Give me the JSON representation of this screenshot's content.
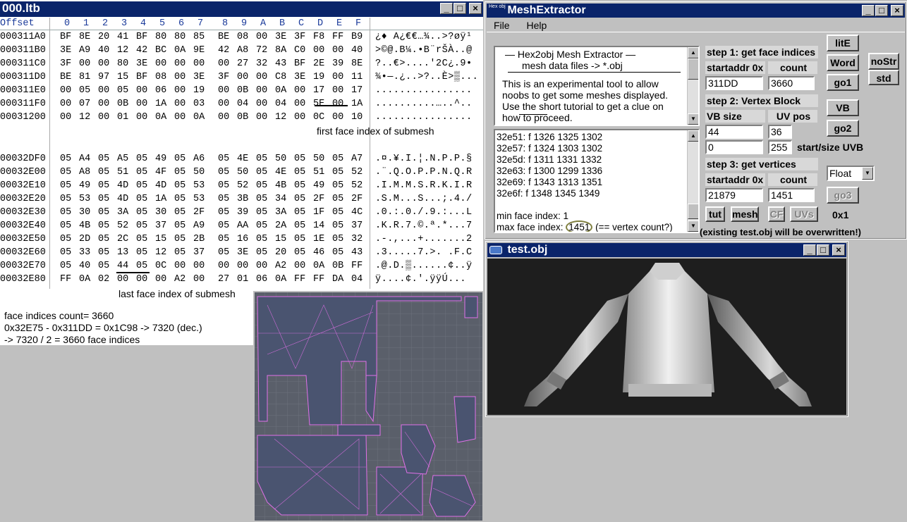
{
  "hex_window": {
    "title": "000.ltb",
    "header_offset": "Offset",
    "header_cols": [
      "0",
      "1",
      "2",
      "3",
      "4",
      "5",
      "6",
      "7",
      "8",
      "9",
      "A",
      "B",
      "C",
      "D",
      "E",
      "F"
    ],
    "block1": [
      {
        "off": "000311A0",
        "bytes": [
          "BF",
          "8E",
          "20",
          "41",
          "BF",
          "80",
          "80",
          "85",
          "BE",
          "08",
          "00",
          "3E",
          "3F",
          "F8",
          "FF",
          "B9"
        ],
        "ascii": "¿♦ A¿€€…¾..>?øÿ¹"
      },
      {
        "off": "000311B0",
        "bytes": [
          "3E",
          "A9",
          "40",
          "12",
          "42",
          "BC",
          "0A",
          "9E",
          "42",
          "A8",
          "72",
          "8A",
          "C0",
          "00",
          "00",
          "40"
        ],
        "ascii": ">©@.B¼.•B¨rŠÀ..@"
      },
      {
        "off": "000311C0",
        "bytes": [
          "3F",
          "00",
          "00",
          "80",
          "3E",
          "00",
          "00",
          "00",
          "00",
          "27",
          "32",
          "43",
          "BF",
          "2E",
          "39",
          "8E"
        ],
        "ascii": "?..€>....'2C¿.9•"
      },
      {
        "off": "000311D0",
        "bytes": [
          "BE",
          "81",
          "97",
          "15",
          "BF",
          "08",
          "00",
          "3E",
          "3F",
          "00",
          "00",
          "C8",
          "3E",
          "19",
          "00",
          "11"
        ],
        "ascii": "¾•—.¿..>?..È>▒..."
      },
      {
        "off": "000311E0",
        "bytes": [
          "00",
          "05",
          "00",
          "05",
          "00",
          "06",
          "00",
          "19",
          "00",
          "0B",
          "00",
          "0A",
          "00",
          "17",
          "00",
          "17"
        ],
        "ascii": "................"
      },
      {
        "off": "000311F0",
        "bytes": [
          "00",
          "07",
          "00",
          "0B",
          "00",
          "1A",
          "00",
          "03",
          "00",
          "04",
          "00",
          "04",
          "00",
          "5E",
          "00",
          "1A"
        ],
        "ascii": "..........…..^.."
      },
      {
        "off": "00031200",
        "bytes": [
          "00",
          "12",
          "00",
          "01",
          "00",
          "0A",
          "00",
          "0A",
          "00",
          "0B",
          "00",
          "12",
          "00",
          "0C",
          "00",
          "10"
        ],
        "ascii": "................"
      }
    ],
    "caption1": "first face index of submesh",
    "block2": [
      {
        "off": "00032DF0",
        "bytes": [
          "05",
          "A4",
          "05",
          "A5",
          "05",
          "49",
          "05",
          "A6",
          "05",
          "4E",
          "05",
          "50",
          "05",
          "50",
          "05",
          "A7"
        ],
        "ascii": ".¤.¥.I.¦.N.P.P.§"
      },
      {
        "off": "00032E00",
        "bytes": [
          "05",
          "A8",
          "05",
          "51",
          "05",
          "4F",
          "05",
          "50",
          "05",
          "50",
          "05",
          "4E",
          "05",
          "51",
          "05",
          "52"
        ],
        "ascii": ".¨.Q.O.P.P.N.Q.R"
      },
      {
        "off": "00032E10",
        "bytes": [
          "05",
          "49",
          "05",
          "4D",
          "05",
          "4D",
          "05",
          "53",
          "05",
          "52",
          "05",
          "4B",
          "05",
          "49",
          "05",
          "52"
        ],
        "ascii": ".I.M.M.S.R.K.I.R"
      },
      {
        "off": "00032E20",
        "bytes": [
          "05",
          "53",
          "05",
          "4D",
          "05",
          "1A",
          "05",
          "53",
          "05",
          "3B",
          "05",
          "34",
          "05",
          "2F",
          "05",
          "2F"
        ],
        "ascii": ".S.M...S...;.4./"
      },
      {
        "off": "00032E30",
        "bytes": [
          "05",
          "30",
          "05",
          "3A",
          "05",
          "30",
          "05",
          "2F",
          "05",
          "39",
          "05",
          "3A",
          "05",
          "1F",
          "05",
          "4C"
        ],
        "ascii": ".0.:.0./.9.:...L"
      },
      {
        "off": "00032E40",
        "bytes": [
          "05",
          "4B",
          "05",
          "52",
          "05",
          "37",
          "05",
          "A9",
          "05",
          "AA",
          "05",
          "2A",
          "05",
          "14",
          "05",
          "37"
        ],
        "ascii": ".K.R.7.©.ª.*...7"
      },
      {
        "off": "00032E50",
        "bytes": [
          "05",
          "2D",
          "05",
          "2C",
          "05",
          "15",
          "05",
          "2B",
          "05",
          "16",
          "05",
          "15",
          "05",
          "1E",
          "05",
          "32"
        ],
        "ascii": ".-.,...+.......2"
      },
      {
        "off": "00032E60",
        "bytes": [
          "05",
          "33",
          "05",
          "13",
          "05",
          "12",
          "05",
          "37",
          "05",
          "3E",
          "05",
          "20",
          "05",
          "46",
          "05",
          "43"
        ],
        "ascii": ".3.....7.>. .F.C"
      },
      {
        "off": "00032E70",
        "bytes": [
          "05",
          "40",
          "05",
          "44",
          "05",
          "0C",
          "00",
          "00",
          "00",
          "00",
          "00",
          "A2",
          "00",
          "0A",
          "0B",
          "FF"
        ],
        "ascii": ".@.D.▒......¢..ÿ"
      },
      {
        "off": "00032E80",
        "bytes": [
          "FF",
          "0A",
          "02",
          "00",
          "00",
          "00",
          "A2",
          "00",
          "27",
          "01",
          "06",
          "0A",
          "FF",
          "FF",
          "DA",
          "04"
        ],
        "ascii": "ÿ....¢.'.ÿÿÚ..."
      }
    ],
    "caption2": "last face index of submesh",
    "notes": [
      "face indices count= 3660",
      "0x32E75 - 0x311DD = 0x1C98 -> 7320 (dec.)",
      "-> 7320 / 2 = 3660 face indices"
    ]
  },
  "mesh_window": {
    "logo": "Hex obj",
    "title": "MeshExtractor",
    "menu": [
      "File",
      "Help"
    ],
    "about_lines": [
      "—  Hex2obj Mesh Extractor  —",
      "mesh data files -> *.obj",
      "",
      "This is an experimental tool to allow",
      "noobs to get some meshes displayed.",
      "Use the short tutorial to get a clue on",
      "how to proceed."
    ],
    "log_lines": [
      "32e51: f  1326 1325 1302",
      "32e57: f  1324 1303 1302",
      "32e5d: f  1311 1331 1332",
      "32e63: f  1300 1299 1336",
      "32e69: f  1343 1313 1351",
      "32e6f: f  1348 1345 1349",
      "",
      "min face index: 1"
    ],
    "log_max_prefix": "max face index: ",
    "log_max_value": "1451",
    "log_max_suffix": " (== vertex count?)",
    "step1": "step 1: get face indices",
    "startaddr_label": "startaddr 0x",
    "count_label": "count",
    "startaddr1": "311DD",
    "count1": "3660",
    "go1": "go1",
    "step2": "step 2: Vertex Block",
    "vbsize_label": "VB size",
    "uvpos_label": "UV pos",
    "vbsize": "44",
    "uvpos": "36",
    "go2": "go2",
    "vb_btn": "VB",
    "uvb_start": "0",
    "uvb_size": "255",
    "uvb_label": "start/size UVB",
    "step3": "step 3: get vertices",
    "startaddr3": "21879",
    "count3": "1451",
    "go3": "go3",
    "format": "Float",
    "btn_lite": "litE",
    "btn_word": "Word",
    "btn_nostr": "noStr",
    "btn_std": "std",
    "btn_tut": "tut",
    "btn_mesh": "mesh",
    "btn_cf": "CF",
    "btn_uvs": "UVs",
    "btn_0x1": "0x1",
    "warning": "(existing test.obj will be overwritten!)"
  },
  "obj_window": {
    "title": "test.obj"
  }
}
